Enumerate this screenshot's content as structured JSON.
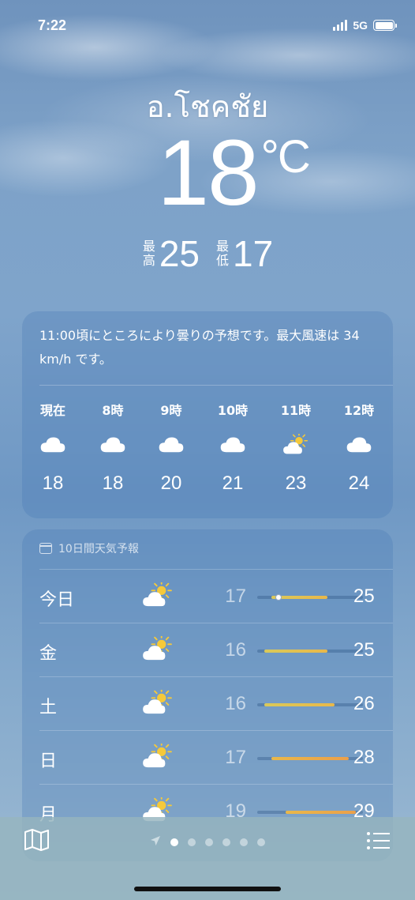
{
  "status_bar": {
    "time": "7:22",
    "network": "5G"
  },
  "location": "อ.โชคชัย",
  "current": {
    "temperature": "18",
    "unit": "°C",
    "high_label": "最高",
    "high": "25",
    "low_label": "最低",
    "low": "17"
  },
  "hourly": {
    "summary": "11:00頃にところにより曇りの予想です。最大風速は 34 km/h です。",
    "items": [
      {
        "label": "現在",
        "icon": "cloud-icon",
        "temp": "18"
      },
      {
        "label": "8時",
        "icon": "cloud-icon",
        "temp": "18"
      },
      {
        "label": "9時",
        "icon": "cloud-icon",
        "temp": "20"
      },
      {
        "label": "10時",
        "icon": "cloud-icon",
        "temp": "21"
      },
      {
        "label": "11時",
        "icon": "partly-sunny-icon",
        "temp": "23"
      },
      {
        "label": "12時",
        "icon": "cloud-icon",
        "temp": "24"
      }
    ]
  },
  "daily": {
    "header": "10日間天気予報",
    "range_scale": [
      15,
      30
    ],
    "items": [
      {
        "day": "今日",
        "icon": "partly-sunny-icon",
        "low": "17",
        "high": "25",
        "current": 18
      },
      {
        "day": "金",
        "icon": "partly-sunny-icon",
        "low": "16",
        "high": "25"
      },
      {
        "day": "土",
        "icon": "partly-sunny-icon",
        "low": "16",
        "high": "26"
      },
      {
        "day": "日",
        "icon": "partly-sunny-icon",
        "low": "17",
        "high": "28"
      },
      {
        "day": "月",
        "icon": "partly-sunny-icon",
        "low": "19",
        "high": "29"
      }
    ]
  },
  "bottom_bar": {
    "map_icon": "map-icon",
    "list_icon": "list-icon",
    "page_count": 6,
    "active_page": 1
  },
  "colors": {
    "sun": "#f5c93a",
    "range_warm": "#e9b84a",
    "range_hot": "#eba04a"
  }
}
